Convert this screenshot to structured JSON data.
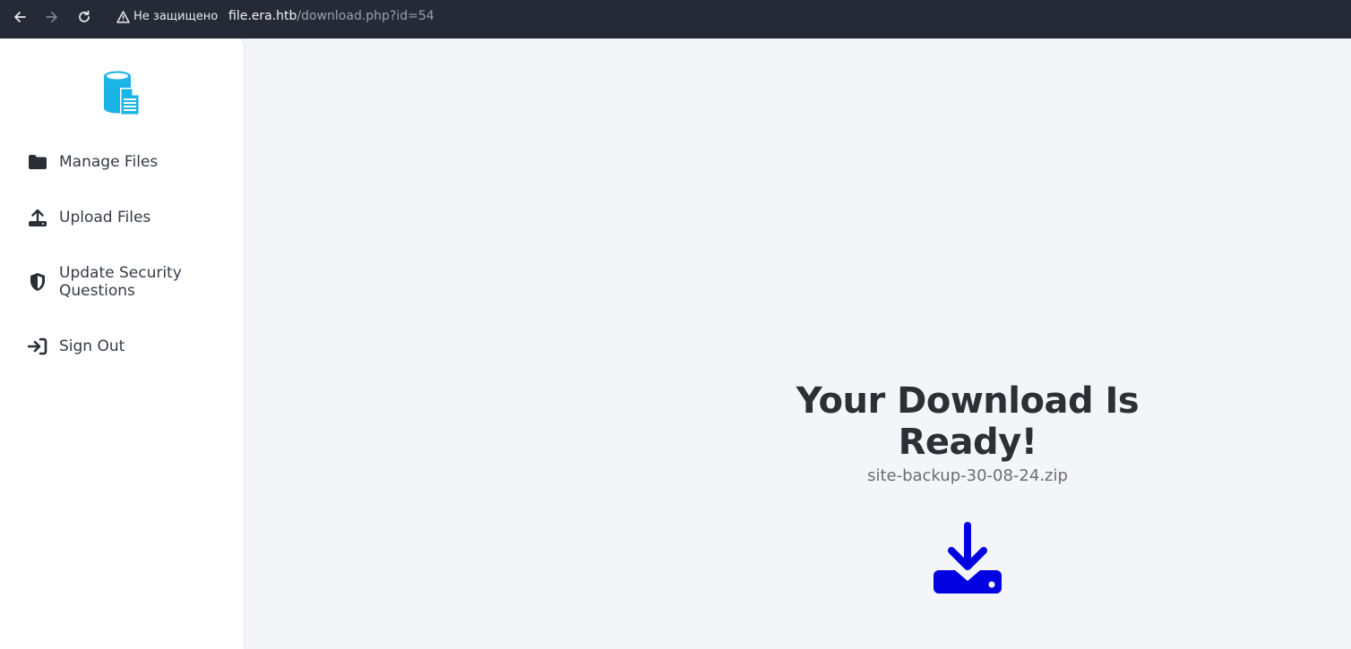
{
  "browser": {
    "security_label": "Не защищено",
    "url_host": "file.era.htb",
    "url_path": "/download.php?id=54"
  },
  "sidebar": {
    "items": [
      {
        "label": "Manage Files",
        "icon": "folder-icon"
      },
      {
        "label": "Upload Files",
        "icon": "upload-icon"
      },
      {
        "label": "Update Security Questions",
        "icon": "shield-icon"
      },
      {
        "label": "Sign Out",
        "icon": "sign-out-icon"
      }
    ]
  },
  "main": {
    "headline": "Your Download Is Ready!",
    "filename": "site-backup-30-08-24.zip",
    "download_icon": "download-icon"
  },
  "colors": {
    "browser_bar": "#262a36",
    "logo_accent": "#1ab4e6",
    "download_accent": "#0000e0",
    "text_dark": "#2d2f35",
    "background": "#f4f5f9"
  }
}
